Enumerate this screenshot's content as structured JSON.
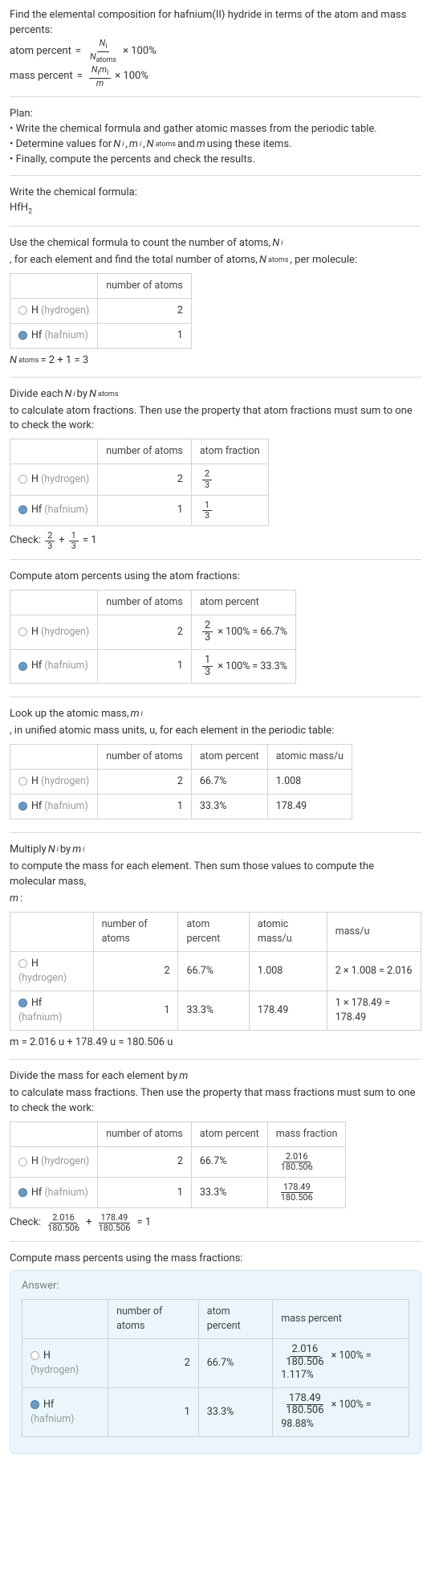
{
  "intro": {
    "line1": "Find the elemental composition for hafnium(II) hydride in terms of the atom and mass percents:",
    "atom_percent_label": "atom percent",
    "mass_percent_label": "mass percent",
    "eq": "=",
    "times100": "× 100%",
    "frac_atom_num": "N",
    "frac_atom_num_sub": "i",
    "frac_atom_den": "N",
    "frac_atom_den_sub": "atoms",
    "frac_mass_num1": "N",
    "frac_mass_num1_sub": "i",
    "frac_mass_num2": "m",
    "frac_mass_num2_sub": "i",
    "frac_mass_den": "m"
  },
  "plan": {
    "title": "Plan:",
    "b1": "• Write the chemical formula and gather atomic masses from the periodic table.",
    "b2_pre": "• Determine values for ",
    "b2_n": "N",
    "b2_nsub": "i",
    "b2_c1": ", ",
    "b2_m": "m",
    "b2_msub": "i",
    "b2_c2": ", ",
    "b2_na": "N",
    "b2_nasub": "atoms",
    "b2_and": " and ",
    "b2_mm": "m",
    "b2_end": " using these items.",
    "b3": "• Finally, compute the percents and check the results."
  },
  "formula_sec": {
    "title": "Write the chemical formula:",
    "formula_main": "HfH",
    "formula_sub": "2"
  },
  "count_sec": {
    "text_pre": "Use the chemical formula to count the number of atoms, ",
    "n": "N",
    "nsub": "i",
    "text_mid": ", for each element and find the total number of atoms, ",
    "na": "N",
    "nasub": "atoms",
    "text_end": ", per molecule:",
    "col_atoms": "number of atoms",
    "row_h_label": "H ",
    "row_h_gray": "(hydrogen)",
    "row_h_val": "2",
    "row_hf_label": "Hf ",
    "row_hf_gray": "(hafnium)",
    "row_hf_val": "1",
    "total_pre": "N",
    "total_sub": "atoms",
    "total_eq": " = 2 + 1 = 3"
  },
  "atomfrac_sec": {
    "text_pre": "Divide each ",
    "n": "N",
    "nsub": "i",
    "text_mid": " by ",
    "na": "N",
    "nasub": "atoms",
    "text_end": " to calculate atom fractions. Then use the property that atom fractions must sum to one to check the work:",
    "col_atoms": "number of atoms",
    "col_frac": "atom fraction",
    "h_atoms": "2",
    "h_num": "2",
    "h_den": "3",
    "hf_atoms": "1",
    "hf_num": "1",
    "hf_den": "3",
    "check_label": "Check: ",
    "check_num1": "2",
    "check_den1": "3",
    "plus": " + ",
    "check_num2": "1",
    "check_den2": "3",
    "eq1": " = 1"
  },
  "atompct_sec": {
    "title": "Compute atom percents using the atom fractions:",
    "col_atoms": "number of atoms",
    "col_pct": "atom percent",
    "h_atoms": "2",
    "h_num": "2",
    "h_den": "3",
    "h_rest": " × 100% = 66.7%",
    "hf_atoms": "1",
    "hf_num": "1",
    "hf_den": "3",
    "hf_rest": " × 100% = 33.3%"
  },
  "mass_lookup_sec": {
    "text_pre": "Look up the atomic mass, ",
    "m": "m",
    "msub": "i",
    "text_end": ", in unified atomic mass units, u, for each element in the periodic table:",
    "col_atoms": "number of atoms",
    "col_pct": "atom percent",
    "col_mass": "atomic mass/u",
    "h_atoms": "2",
    "h_pct": "66.7%",
    "h_mass": "1.008",
    "hf_atoms": "1",
    "hf_pct": "33.3%",
    "hf_mass": "178.49"
  },
  "mass_calc_sec": {
    "text_pre": "Multiply ",
    "n": "N",
    "nsub": "i",
    "by": " by ",
    "m": "m",
    "msub": "i",
    "text_end_pre": " to compute the mass for each element. Then sum those values to compute the molecular mass, ",
    "mm": "m",
    "colon": ":",
    "col_atoms": "number of atoms",
    "col_pct": "atom percent",
    "col_amass": "atomic mass/u",
    "col_mass": "mass/u",
    "h_atoms": "2",
    "h_pct": "66.7%",
    "h_amass": "1.008",
    "h_mass": "2 × 1.008 = 2.016",
    "hf_atoms": "1",
    "hf_pct": "33.3%",
    "hf_amass": "178.49",
    "hf_mass": "1 × 178.49 = 178.49",
    "total": "m = 2.016 u + 178.49 u = 180.506 u"
  },
  "massfrac_sec": {
    "text_pre": "Divide the mass for each element by ",
    "m": "m",
    "text_end": " to calculate mass fractions. Then use the property that mass fractions must sum to one to check the work:",
    "col_atoms": "number of atoms",
    "col_pct": "atom percent",
    "col_frac": "mass fraction",
    "h_atoms": "2",
    "h_pct": "66.7%",
    "h_num": "2.016",
    "h_den": "180.506",
    "hf_atoms": "1",
    "hf_pct": "33.3%",
    "hf_num": "178.49",
    "hf_den": "180.506",
    "check_label": "Check: ",
    "c1_num": "2.016",
    "c1_den": "180.506",
    "plus": " + ",
    "c2_num": "178.49",
    "c2_den": "180.506",
    "eq1": " = 1"
  },
  "masspct_sec": {
    "title": "Compute mass percents using the mass fractions:"
  },
  "answer": {
    "label": "Answer:",
    "col_atoms": "number of atoms",
    "col_apct": "atom percent",
    "col_mpct": "mass percent",
    "h_atoms": "2",
    "h_apct": "66.7%",
    "h_num": "2.016",
    "h_den": "180.506",
    "h_rest": " × 100% = 1.117%",
    "hf_atoms": "1",
    "hf_apct": "33.3%",
    "hf_num": "178.49",
    "hf_den": "180.506",
    "hf_rest": " × 100% = 98.88%"
  },
  "labels": {
    "h_label": "H ",
    "h_gray": "(hydrogen)",
    "hf_label": "Hf ",
    "hf_gray": "(hafnium)"
  },
  "chart_data": {
    "type": "table",
    "elements": [
      {
        "symbol": "H",
        "name": "hydrogen",
        "number_of_atoms": 2,
        "atom_fraction": "2/3",
        "atom_percent": 66.7,
        "atomic_mass_u": 1.008,
        "mass_u": 2.016,
        "mass_fraction": "2.016/180.506",
        "mass_percent": 1.117
      },
      {
        "symbol": "Hf",
        "name": "hafnium",
        "number_of_atoms": 1,
        "atom_fraction": "1/3",
        "atom_percent": 33.3,
        "atomic_mass_u": 178.49,
        "mass_u": 178.49,
        "mass_fraction": "178.49/180.506",
        "mass_percent": 98.88
      }
    ],
    "N_atoms": 3,
    "molecular_mass_u": 180.506,
    "formula": "HfH2"
  }
}
